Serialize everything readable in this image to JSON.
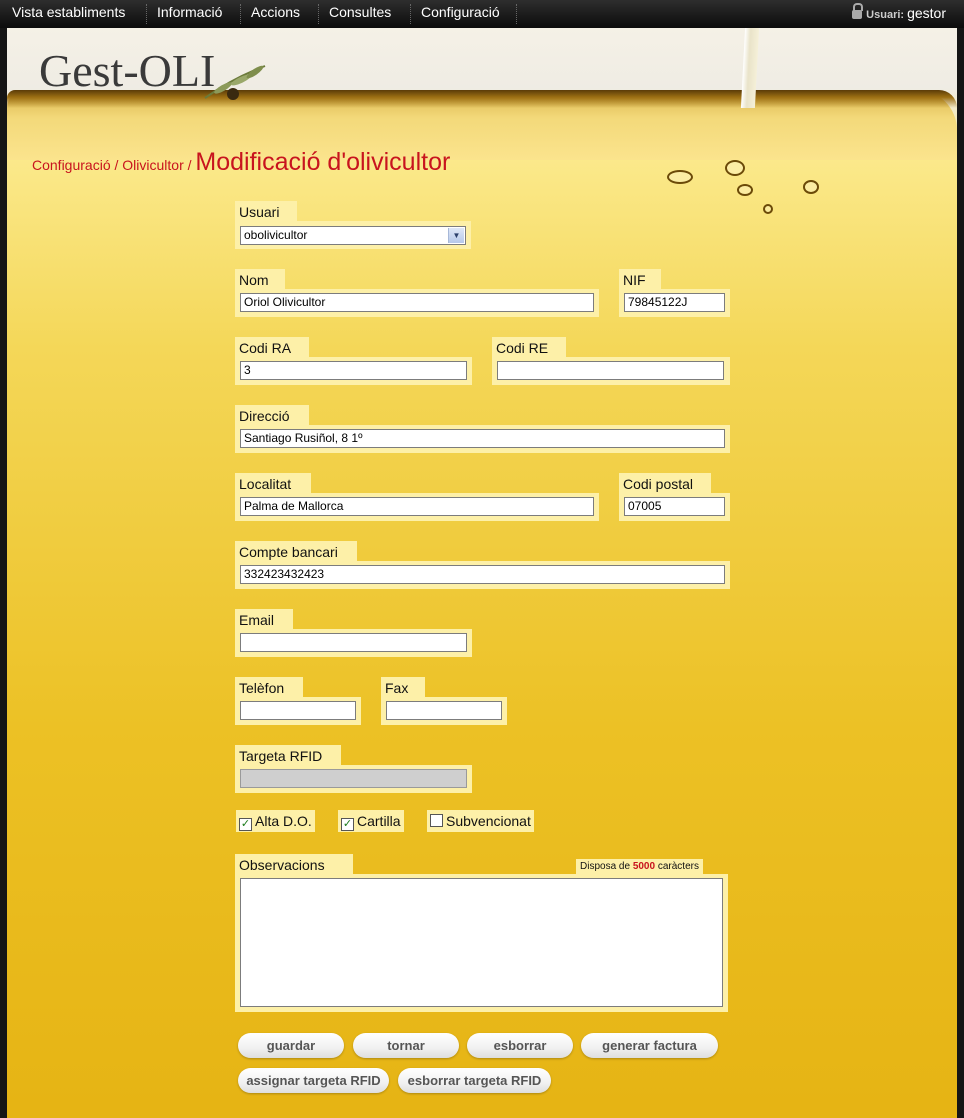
{
  "nav": {
    "items": [
      "Vista establiments",
      "Informació",
      "Accions",
      "Consultes",
      "Configuració"
    ],
    "user_label": "Usuari:",
    "user_name": "gestor"
  },
  "logo_text": "Gest-OLI",
  "breadcrumb": {
    "level1": "Configuració",
    "separator": "/",
    "level2": "Olivicultor",
    "current": "Modificació d'olivicultor"
  },
  "form": {
    "usuari": {
      "label": "Usuari",
      "value": "obolivicultor"
    },
    "nom": {
      "label": "Nom",
      "value": "Oriol Olivicultor"
    },
    "nif": {
      "label": "NIF",
      "value": "79845122J"
    },
    "codi_ra": {
      "label": "Codi RA",
      "value": "3"
    },
    "codi_re": {
      "label": "Codi RE",
      "value": ""
    },
    "direccio": {
      "label": "Direcció",
      "value": "Santiago Rusiñol, 8  1º"
    },
    "localitat": {
      "label": "Localitat",
      "value": "Palma de Mallorca"
    },
    "codi_postal": {
      "label": "Codi postal",
      "value": "07005"
    },
    "compte_bancari": {
      "label": "Compte bancari",
      "value": "332423432423"
    },
    "email": {
      "label": "Email",
      "value": ""
    },
    "telefon": {
      "label": "Telèfon",
      "value": ""
    },
    "fax": {
      "label": "Fax",
      "value": ""
    },
    "targeta_rfid": {
      "label": "Targeta RFID",
      "value": ""
    },
    "checkboxes": [
      {
        "label": "Alta D.O.",
        "checked": true
      },
      {
        "label": "Cartilla",
        "checked": true
      },
      {
        "label": "Subvencionat",
        "checked": false
      }
    ],
    "observacions": {
      "label": "Observacions",
      "counter_prefix": "Disposa de",
      "counter_value": "5000",
      "counter_suffix": "caràcters",
      "value": ""
    }
  },
  "buttons": {
    "guardar": "guardar",
    "tornar": "tornar",
    "esborrar": "esborrar",
    "generar_factura": "generar factura",
    "assignar_targeta": "assignar targeta RFID",
    "esborrar_targeta": "esborrar targeta RFID"
  },
  "check_mark": "✓",
  "dropdown_arrow": "▼",
  "colors": {
    "accent_red": "#c8141e",
    "label_bg": "#fdf0a8"
  }
}
